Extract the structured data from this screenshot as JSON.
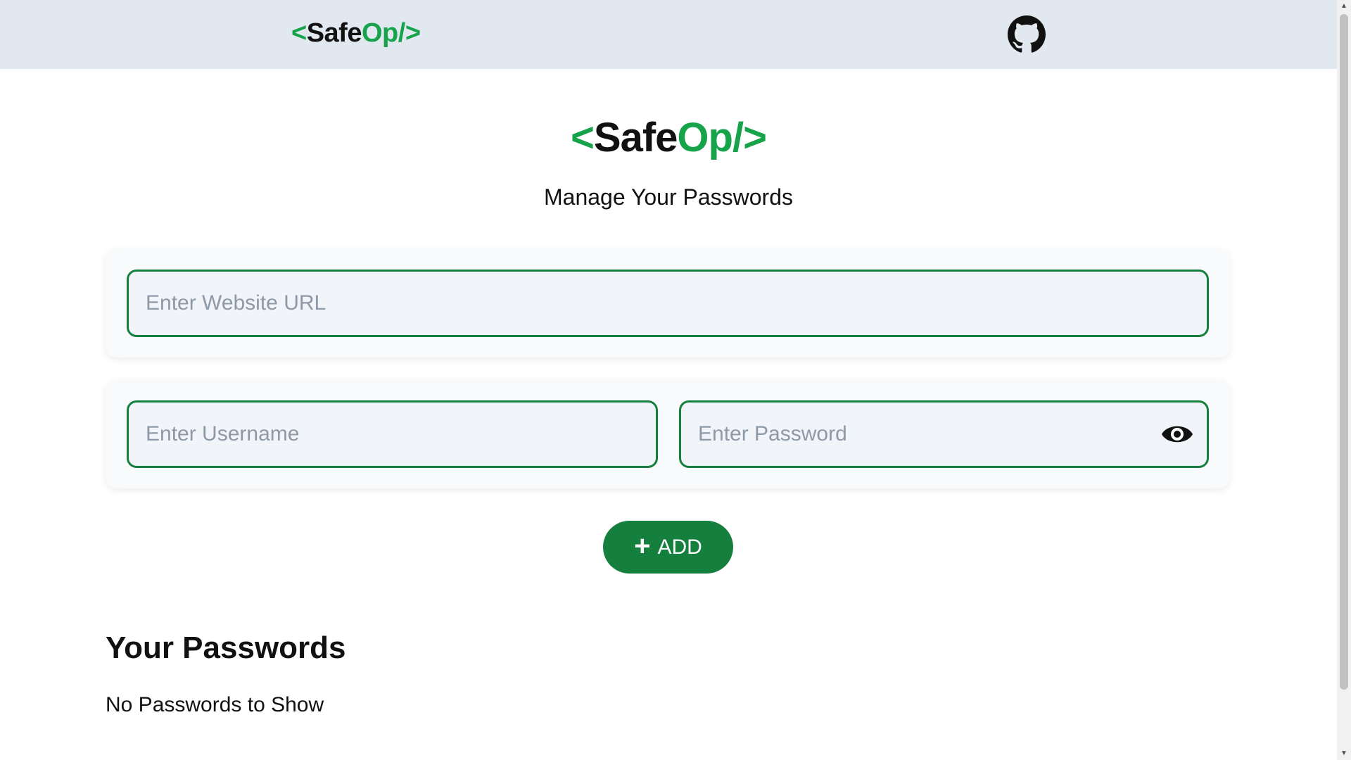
{
  "brand": {
    "open": "<",
    "name_a": "Safe",
    "name_b": "Op/",
    "close": ">"
  },
  "navbar": {
    "github_icon": "github-icon"
  },
  "hero": {
    "subtitle": "Manage Your Passwords"
  },
  "form": {
    "url_placeholder": "Enter Website URL",
    "username_placeholder": "Enter Username",
    "password_placeholder": "Enter Password",
    "password_toggle_icon": "eye-icon",
    "add_label": "ADD",
    "add_icon": "+"
  },
  "passwords": {
    "title": "Your Passwords",
    "empty_message": "No Passwords to Show"
  },
  "colors": {
    "accent_green": "#16a34a",
    "button_green": "#15803d",
    "navbar_bg": "#e2e8f0",
    "input_bg": "#f1f5f9"
  }
}
